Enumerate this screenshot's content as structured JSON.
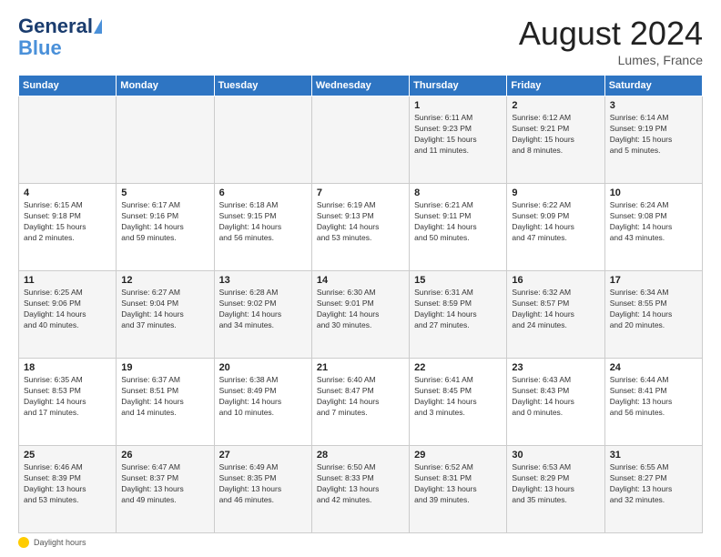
{
  "header": {
    "logo_main": "General",
    "logo_accent": "Blue",
    "month_year": "August 2024",
    "location": "Lumes, France"
  },
  "days_of_week": [
    "Sunday",
    "Monday",
    "Tuesday",
    "Wednesday",
    "Thursday",
    "Friday",
    "Saturday"
  ],
  "footer": {
    "label": "Daylight hours"
  },
  "weeks": [
    [
      {
        "num": "",
        "info": ""
      },
      {
        "num": "",
        "info": ""
      },
      {
        "num": "",
        "info": ""
      },
      {
        "num": "",
        "info": ""
      },
      {
        "num": "1",
        "info": "Sunrise: 6:11 AM\nSunset: 9:23 PM\nDaylight: 15 hours\nand 11 minutes."
      },
      {
        "num": "2",
        "info": "Sunrise: 6:12 AM\nSunset: 9:21 PM\nDaylight: 15 hours\nand 8 minutes."
      },
      {
        "num": "3",
        "info": "Sunrise: 6:14 AM\nSunset: 9:19 PM\nDaylight: 15 hours\nand 5 minutes."
      }
    ],
    [
      {
        "num": "4",
        "info": "Sunrise: 6:15 AM\nSunset: 9:18 PM\nDaylight: 15 hours\nand 2 minutes."
      },
      {
        "num": "5",
        "info": "Sunrise: 6:17 AM\nSunset: 9:16 PM\nDaylight: 14 hours\nand 59 minutes."
      },
      {
        "num": "6",
        "info": "Sunrise: 6:18 AM\nSunset: 9:15 PM\nDaylight: 14 hours\nand 56 minutes."
      },
      {
        "num": "7",
        "info": "Sunrise: 6:19 AM\nSunset: 9:13 PM\nDaylight: 14 hours\nand 53 minutes."
      },
      {
        "num": "8",
        "info": "Sunrise: 6:21 AM\nSunset: 9:11 PM\nDaylight: 14 hours\nand 50 minutes."
      },
      {
        "num": "9",
        "info": "Sunrise: 6:22 AM\nSunset: 9:09 PM\nDaylight: 14 hours\nand 47 minutes."
      },
      {
        "num": "10",
        "info": "Sunrise: 6:24 AM\nSunset: 9:08 PM\nDaylight: 14 hours\nand 43 minutes."
      }
    ],
    [
      {
        "num": "11",
        "info": "Sunrise: 6:25 AM\nSunset: 9:06 PM\nDaylight: 14 hours\nand 40 minutes."
      },
      {
        "num": "12",
        "info": "Sunrise: 6:27 AM\nSunset: 9:04 PM\nDaylight: 14 hours\nand 37 minutes."
      },
      {
        "num": "13",
        "info": "Sunrise: 6:28 AM\nSunset: 9:02 PM\nDaylight: 14 hours\nand 34 minutes."
      },
      {
        "num": "14",
        "info": "Sunrise: 6:30 AM\nSunset: 9:01 PM\nDaylight: 14 hours\nand 30 minutes."
      },
      {
        "num": "15",
        "info": "Sunrise: 6:31 AM\nSunset: 8:59 PM\nDaylight: 14 hours\nand 27 minutes."
      },
      {
        "num": "16",
        "info": "Sunrise: 6:32 AM\nSunset: 8:57 PM\nDaylight: 14 hours\nand 24 minutes."
      },
      {
        "num": "17",
        "info": "Sunrise: 6:34 AM\nSunset: 8:55 PM\nDaylight: 14 hours\nand 20 minutes."
      }
    ],
    [
      {
        "num": "18",
        "info": "Sunrise: 6:35 AM\nSunset: 8:53 PM\nDaylight: 14 hours\nand 17 minutes."
      },
      {
        "num": "19",
        "info": "Sunrise: 6:37 AM\nSunset: 8:51 PM\nDaylight: 14 hours\nand 14 minutes."
      },
      {
        "num": "20",
        "info": "Sunrise: 6:38 AM\nSunset: 8:49 PM\nDaylight: 14 hours\nand 10 minutes."
      },
      {
        "num": "21",
        "info": "Sunrise: 6:40 AM\nSunset: 8:47 PM\nDaylight: 14 hours\nand 7 minutes."
      },
      {
        "num": "22",
        "info": "Sunrise: 6:41 AM\nSunset: 8:45 PM\nDaylight: 14 hours\nand 3 minutes."
      },
      {
        "num": "23",
        "info": "Sunrise: 6:43 AM\nSunset: 8:43 PM\nDaylight: 14 hours\nand 0 minutes."
      },
      {
        "num": "24",
        "info": "Sunrise: 6:44 AM\nSunset: 8:41 PM\nDaylight: 13 hours\nand 56 minutes."
      }
    ],
    [
      {
        "num": "25",
        "info": "Sunrise: 6:46 AM\nSunset: 8:39 PM\nDaylight: 13 hours\nand 53 minutes."
      },
      {
        "num": "26",
        "info": "Sunrise: 6:47 AM\nSunset: 8:37 PM\nDaylight: 13 hours\nand 49 minutes."
      },
      {
        "num": "27",
        "info": "Sunrise: 6:49 AM\nSunset: 8:35 PM\nDaylight: 13 hours\nand 46 minutes."
      },
      {
        "num": "28",
        "info": "Sunrise: 6:50 AM\nSunset: 8:33 PM\nDaylight: 13 hours\nand 42 minutes."
      },
      {
        "num": "29",
        "info": "Sunrise: 6:52 AM\nSunset: 8:31 PM\nDaylight: 13 hours\nand 39 minutes."
      },
      {
        "num": "30",
        "info": "Sunrise: 6:53 AM\nSunset: 8:29 PM\nDaylight: 13 hours\nand 35 minutes."
      },
      {
        "num": "31",
        "info": "Sunrise: 6:55 AM\nSunset: 8:27 PM\nDaylight: 13 hours\nand 32 minutes."
      }
    ]
  ]
}
